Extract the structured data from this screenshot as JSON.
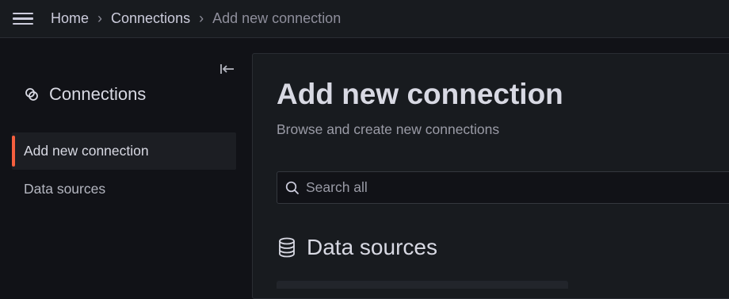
{
  "breadcrumb": {
    "items": [
      {
        "label": "Home"
      },
      {
        "label": "Connections"
      },
      {
        "label": "Add new connection"
      }
    ],
    "separator": "›"
  },
  "sidebar": {
    "title": "Connections",
    "title_icon": "connections-icon",
    "collapse_icon": "collapse-left-icon",
    "items": [
      {
        "label": "Add new connection",
        "active": true
      },
      {
        "label": "Data sources",
        "active": false
      }
    ],
    "accent_color": "#f55f3e"
  },
  "main": {
    "title": "Add new connection",
    "subtitle": "Browse and create new connections",
    "search": {
      "placeholder": "Search all",
      "value": "",
      "icon": "search-icon"
    },
    "section": {
      "title": "Data sources",
      "icon": "database-icon"
    }
  }
}
